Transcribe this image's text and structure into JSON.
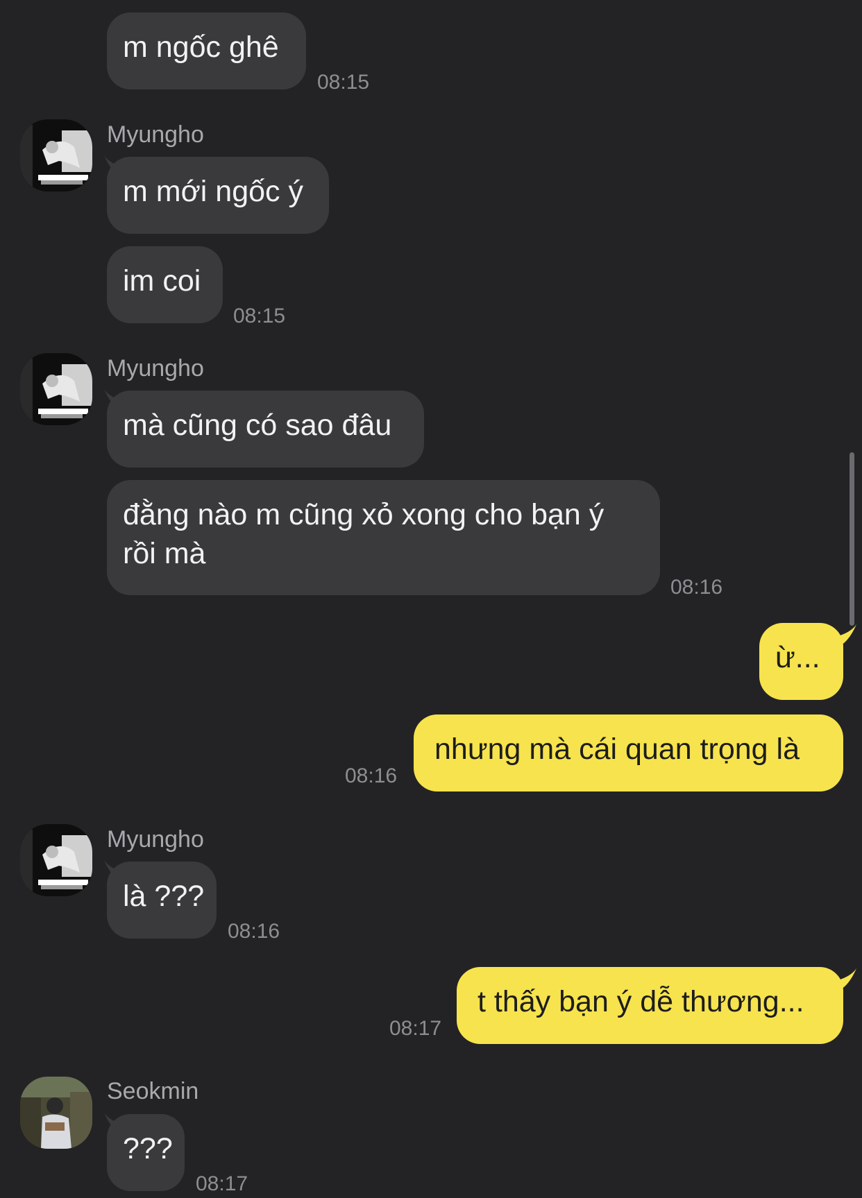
{
  "contacts": {
    "myungho": {
      "name": "Myungho",
      "avatar_icon": "avatar-photo-icon"
    },
    "seokmin": {
      "name": "Seokmin",
      "avatar_icon": "avatar-photo-icon"
    }
  },
  "colors": {
    "background": "#232325",
    "incoming_bubble": "#3a3a3d",
    "outgoing_bubble": "#f7e34d",
    "timestamp": "#8e8e92"
  },
  "messages": [
    {
      "sender": "Myungho",
      "text": "m ngốc ghê",
      "time": "08:15"
    },
    {
      "sender": "Myungho",
      "text": "m mới ngốc ý"
    },
    {
      "sender": "Myungho",
      "text": "im coi",
      "time": "08:15"
    },
    {
      "sender": "Myungho",
      "text": "mà cũng có sao đâu"
    },
    {
      "sender": "Myungho",
      "text": "đằng nào m cũng xỏ xong cho bạn ý rồi mà",
      "time": "08:16"
    },
    {
      "sender": "me",
      "text": "ừ..."
    },
    {
      "sender": "me",
      "text": "nhưng mà cái quan trọng là",
      "time": "08:16"
    },
    {
      "sender": "Myungho",
      "text": "là ???",
      "time": "08:16"
    },
    {
      "sender": "me",
      "text": "t thấy bạn ý dễ thương...",
      "time": "08:17"
    },
    {
      "sender": "Seokmin",
      "text": "???",
      "time": "08:17"
    }
  ]
}
